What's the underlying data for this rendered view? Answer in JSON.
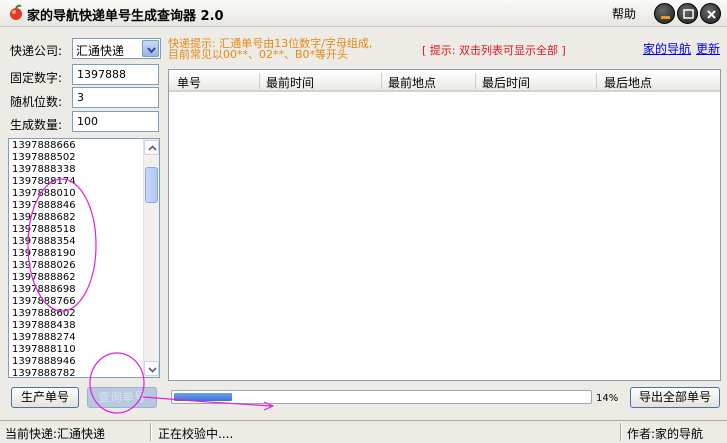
{
  "window": {
    "title": "家的导航快递单号生成查询器 2.0",
    "help": "帮助"
  },
  "form": {
    "courier_label": "快递公司:",
    "courier_value": "汇通快递",
    "fixed_label": "固定数字:",
    "fixed_value": "1397888",
    "random_label": "随机位数:",
    "random_value": "3",
    "count_label": "生成数量:",
    "count_value": "100"
  },
  "numbers": [
    "1397888666",
    "1397888502",
    "1397888338",
    "1397888174",
    "1397888010",
    "1397888846",
    "1397888682",
    "1397888518",
    "1397888354",
    "1397888190",
    "1397888026",
    "1397888862",
    "1397888698",
    "1397888766",
    "1397888602",
    "1397888438",
    "1397888274",
    "1397888110",
    "1397888946",
    "1397888782"
  ],
  "tip": {
    "line1": "快递提示: 汇通单号由13位数字/字母组成,",
    "line2": "目前常见以00**、02**、B0*等开头",
    "hint": "[ 提示: 双击列表可显示全部 ]"
  },
  "links": {
    "home": "家的导航",
    "update": "更新"
  },
  "table": {
    "columns": [
      "单号",
      "最前时间",
      "最前地点",
      "最后时间",
      "最后地点"
    ]
  },
  "buttons": {
    "generate": "生产单号",
    "query": "查询单号",
    "export": "导出全部单号"
  },
  "progress": {
    "percent": 14,
    "text": "14%"
  },
  "status": {
    "courier": "当前快递:汇通快递",
    "state": "正在校验中....",
    "author": "作者:家的导航"
  },
  "colors": {
    "tip": "#E38A14",
    "hint": "#E0141E",
    "link": "#0000EE",
    "annotation": "#E020E0"
  }
}
